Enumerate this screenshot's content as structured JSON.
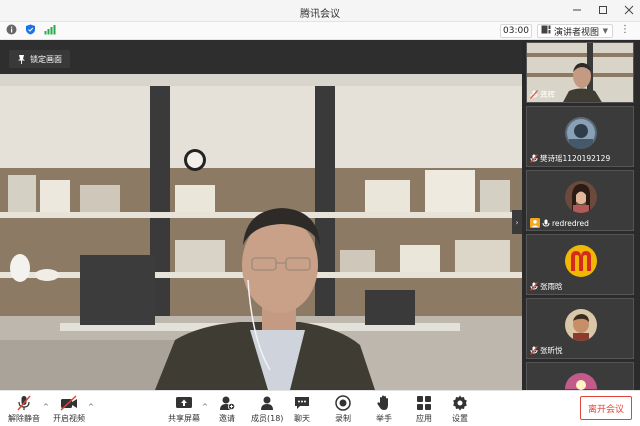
{
  "window": {
    "title": "腾讯会议"
  },
  "toolbar": {
    "timer": "03:00",
    "view_mode": "演讲者视图"
  },
  "main": {
    "lock_label": "锁定画面"
  },
  "participants": [
    {
      "name": "龚辉",
      "mic": "muted"
    },
    {
      "name": "樊诗瑶1120192129",
      "mic": "muted"
    },
    {
      "name": "redredred",
      "mic": "active"
    },
    {
      "name": "张雨晗",
      "mic": "muted"
    },
    {
      "name": "张昕悦",
      "mic": "muted"
    },
    {
      "name": "",
      "mic": ""
    }
  ],
  "bottombar": {
    "unmute": "解除静音",
    "video": "开启视频",
    "share": "共享屏幕",
    "invite": "邀请",
    "members": "成员(18)",
    "chat": "聊天",
    "record": "录制",
    "raise_hand": "举手",
    "apps": "应用",
    "settings": "设置",
    "leave": "离开会议"
  },
  "colors": {
    "accent": "#1a73e8",
    "leave": "#e0443a",
    "muted_red": "#e0443a",
    "active_orange": "#f5a623"
  }
}
